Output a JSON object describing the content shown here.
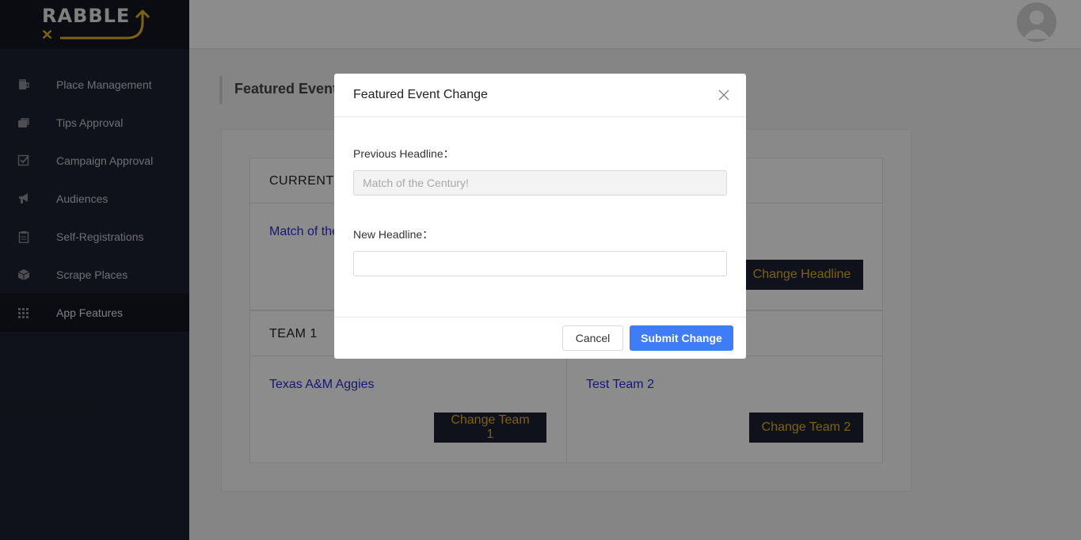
{
  "logo": {
    "text": "RABBLE",
    "mark": "✕"
  },
  "sidebar": {
    "items": [
      {
        "icon": "mug-icon",
        "label": "Place Management"
      },
      {
        "icon": "cards-icon",
        "label": "Tips Approval"
      },
      {
        "icon": "checkbox-icon",
        "label": "Campaign Approval"
      },
      {
        "icon": "megaphone-icon",
        "label": "Audiences"
      },
      {
        "icon": "clipboard-icon",
        "label": "Self-Registrations"
      },
      {
        "icon": "cube-icon",
        "label": "Scrape Places"
      },
      {
        "icon": "grid-icon",
        "label": "App Features",
        "active": true
      }
    ]
  },
  "page": {
    "title": "Featured Event"
  },
  "cards": {
    "current": {
      "header": "CURRENT",
      "link": "Match of the Century!",
      "button": "Change Headline"
    },
    "teams": {
      "header": "TEAM 1",
      "team1": {
        "name": "Texas A&M Aggies",
        "button": "Change Team 1"
      },
      "team2": {
        "name": "Test Team 2",
        "button": "Change Team 2"
      }
    }
  },
  "modal": {
    "title": "Featured Event Change",
    "previous_label": "Previous Headline：",
    "previous_value": "Match of the Century!",
    "new_label": "New Headline：",
    "new_value": "",
    "cancel": "Cancel",
    "submit": "Submit Change"
  },
  "colors": {
    "accent": "#e3b21c",
    "sidebar": "#1d2130",
    "primary": "#3f7cf7",
    "link": "#2a2ad8"
  }
}
